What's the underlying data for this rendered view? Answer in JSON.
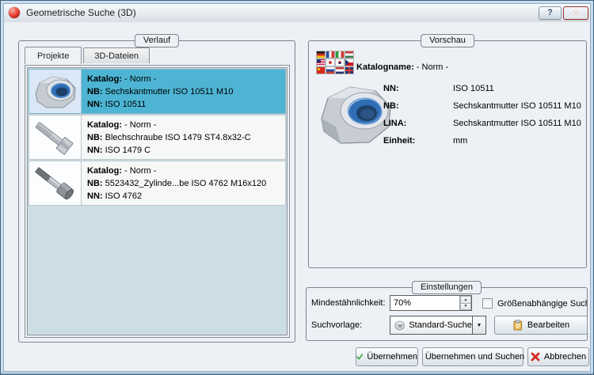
{
  "window": {
    "title": "Geometrische Suche (3D)",
    "help": "?"
  },
  "verlauf": {
    "label": "Verlauf",
    "tabs": [
      {
        "label": "Projekte"
      },
      {
        "label": "3D-Dateien"
      }
    ],
    "items": [
      {
        "katalog_label": "Katalog:",
        "katalog": "- Norm -",
        "nb_label": "NB:",
        "nb": "Sechskantmutter ISO 10511 M10",
        "nn_label": "NN:",
        "nn": "ISO 10511",
        "thumbnail": "locknut",
        "selected": true
      },
      {
        "katalog_label": "Katalog:",
        "katalog": "- Norm -",
        "nb_label": "NB:",
        "nb": "Blechschraube ISO 1479 ST4.8x32-C",
        "nn_label": "NN:",
        "nn": "ISO 1479 C",
        "thumbnail": "hex-screw",
        "selected": false
      },
      {
        "katalog_label": "Katalog:",
        "katalog": "- Norm -",
        "nb_label": "NB:",
        "nb": "5523432_Zylinde...be ISO 4762 M16x120",
        "nn_label": "NN:",
        "nn": "ISO 4762",
        "thumbnail": "socket-screw",
        "selected": false
      }
    ]
  },
  "vorschau": {
    "label": "Vorschau",
    "katalogname_label": "Katalogname:",
    "katalogname_value": "- Norm -",
    "fields": [
      {
        "label": "NN:",
        "value": "ISO 10511"
      },
      {
        "label": "NB:",
        "value": "Sechskantmutter ISO 10511 M10"
      },
      {
        "label": "LINA:",
        "value": "Sechskantmutter ISO 10511 M10"
      },
      {
        "label": "Einheit:",
        "value": "mm"
      }
    ]
  },
  "einstellungen": {
    "label": "Einstellungen",
    "min_similarity_label": "Mindestähnlichkeit:",
    "min_similarity_value": "70%",
    "size_dependent_label": "Größenabhängige Suche",
    "size_dependent_checked": false,
    "search_template_label": "Suchvorlage:",
    "search_template_value": "Standard-Suche",
    "edit_button_label": "Bearbeiten"
  },
  "footer": {
    "apply_label": "Übernehmen",
    "apply_search_label": "Übernehmen und Suchen",
    "cancel_label": "Abbrechen"
  },
  "colors": {
    "selection_cyan": "#4db5d3",
    "list_background": "#cddde4",
    "close_button_red": "#c23a2e",
    "check_green": "#3fa53f",
    "cancel_red": "#d22d22",
    "nut_insert_blue": "#2f6db4"
  }
}
